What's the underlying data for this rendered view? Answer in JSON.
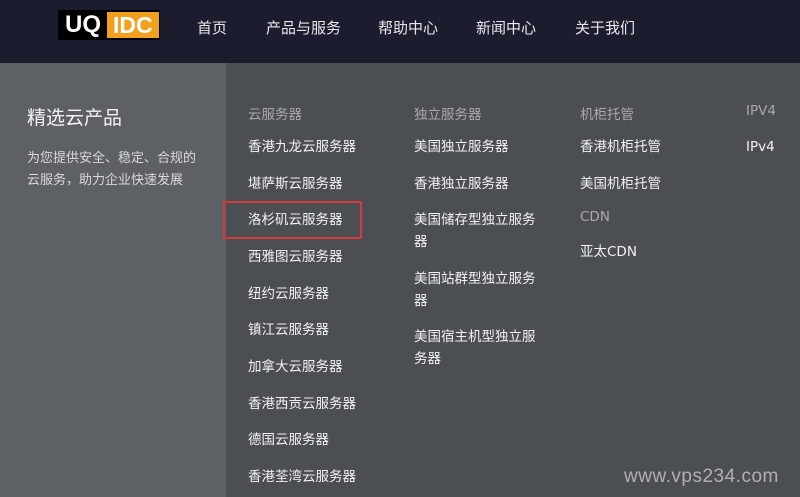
{
  "logo": {
    "part1": "UQ",
    "part2_main": "IDC",
    "part2_accent": ""
  },
  "nav": [
    "首页",
    "产品与服务",
    "帮助中心",
    "新闻中心",
    "关于我们"
  ],
  "side": {
    "title": "精选云产品",
    "description": "为您提供安全、稳定、合规的云服务，助力企业快速发展"
  },
  "columns": {
    "cloud": {
      "category": "云服务器",
      "items": [
        "香港九龙云服务器",
        "堪萨斯云服务器",
        "洛杉矶云服务器",
        "西雅图云服务器",
        "纽约云服务器",
        "镇江云服务器",
        "加拿大云服务器",
        "香港西贡云服务器",
        "德国云服务器",
        "香港荃湾云服务器"
      ]
    },
    "dedicated": {
      "category": "独立服务器",
      "items": [
        "美国独立服务器",
        "香港独立服务器",
        "美国储存型独立服务器",
        "美国站群型独立服务器",
        "美国宿主机型独立服务器"
      ]
    },
    "colo": {
      "category": "机柜托管",
      "items": [
        "香港机柜托管",
        "美国机柜托管"
      ]
    },
    "cdn": {
      "category": "CDN",
      "items": [
        "亚太CDN"
      ]
    },
    "ipv4": {
      "category": "IPV4",
      "items": [
        "IPv4"
      ]
    }
  },
  "watermark": "www.vps234.com"
}
